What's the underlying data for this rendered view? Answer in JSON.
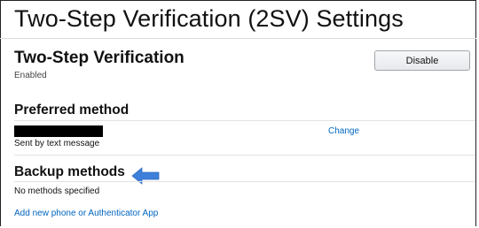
{
  "page": {
    "title": "Two-Step Verification (2SV) Settings"
  },
  "two_step": {
    "heading": "Two-Step Verification",
    "status": "Enabled",
    "disable_label": "Disable"
  },
  "preferred": {
    "heading": "Preferred method",
    "detail": "Sent by text message",
    "change_label": "Change"
  },
  "backup": {
    "heading": "Backup methods",
    "empty_text": "No methods specified",
    "add_label": "Add new phone or Authenticator App"
  },
  "colors": {
    "link": "#0066c0",
    "arrow": "#3d7fd9"
  },
  "icons": {
    "annotation": "left-arrow-icon"
  }
}
